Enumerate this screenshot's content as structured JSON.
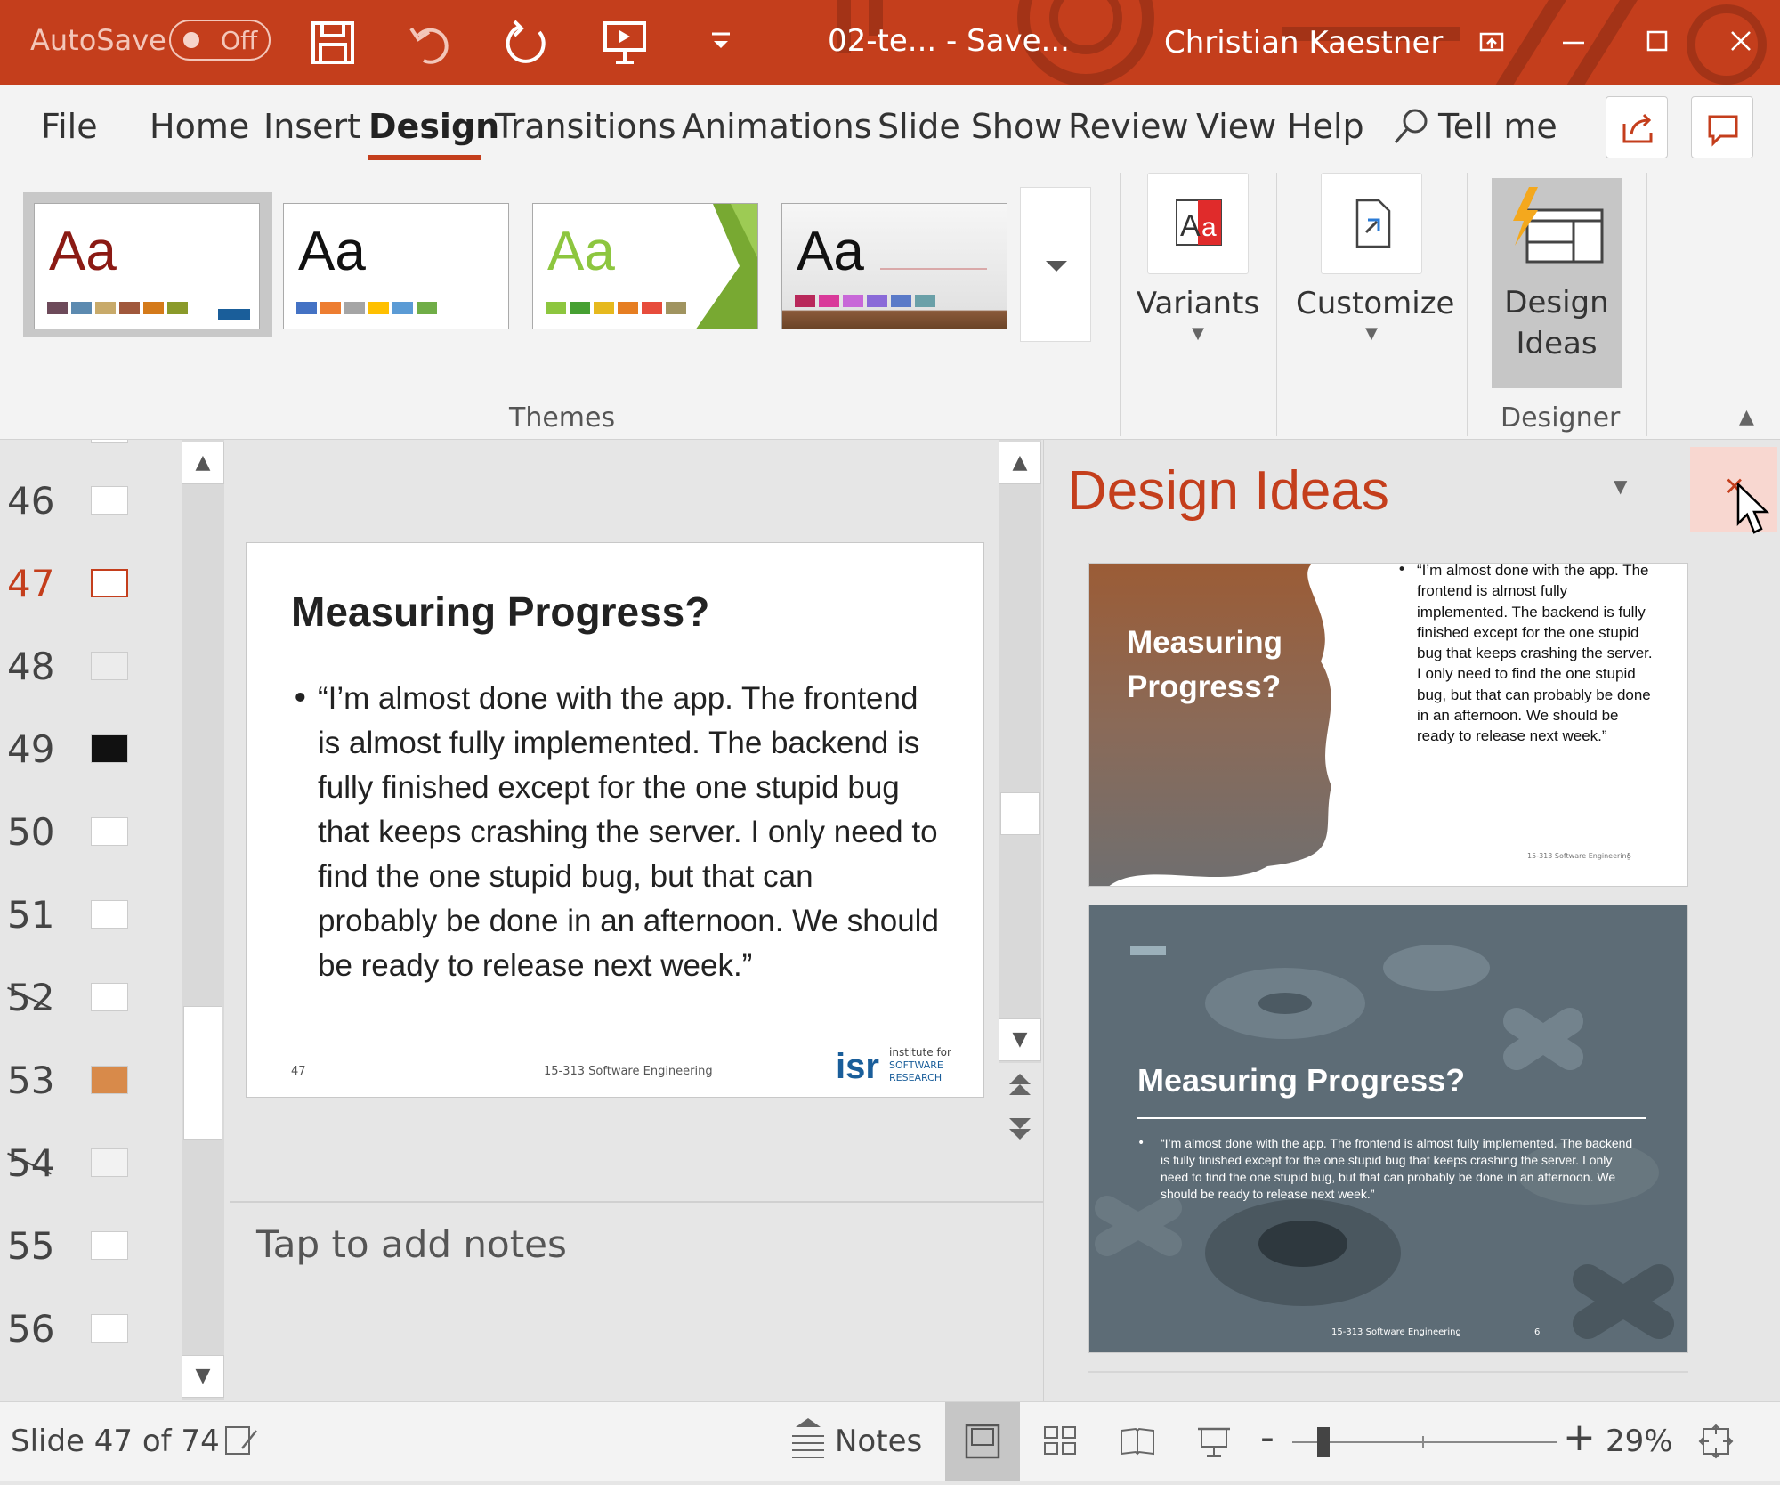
{
  "titlebar": {
    "autosave_label": "AutoSave",
    "autosave_state": "Off",
    "doc_title": "02-te...  -  Save...",
    "user_name": "Christian Kaestner",
    "accent": "#c43e1c"
  },
  "tabs": [
    "File",
    "Home",
    "Insert",
    "Design",
    "Transitions",
    "Animations",
    "Slide Show",
    "Review",
    "View",
    "Help",
    "Tell me"
  ],
  "ribbon": {
    "themes_label": "Themes",
    "theme_aa": "Aa",
    "variants_label": "Variants",
    "customize_label": "Customize",
    "design_ideas_label_1": "Design",
    "design_ideas_label_2": "Ideas",
    "designer_label": "Designer"
  },
  "thumbnails": [
    "46",
    "47",
    "48",
    "49",
    "50",
    "51",
    "52",
    "53",
    "54",
    "55",
    "56"
  ],
  "current_slide": "47",
  "slide": {
    "title": "Measuring Progress?",
    "bullet": "“I’m almost done with the app. The frontend is almost fully implemented. The backend is fully finished except for the one stupid bug that keeps crashing the server. I only need to find the one stupid bug, but that can probably be done in an afternoon. We should be ready to release next week.”",
    "number": "47",
    "footer": "15-313 Software Engineering",
    "logo_text": "isr",
    "logo_sub_1": "institute for",
    "logo_sub_2": "SOFTWARE",
    "logo_sub_3": "RESEARCH"
  },
  "notes_placeholder": "Tap to add notes",
  "design_ideas": {
    "title": "Design Ideas",
    "idea1": {
      "title": "Measuring Progress?",
      "text": "“I’m almost done with the app. The frontend is almost fully implemented. The backend is fully finished except for the one stupid bug that keeps crashing the server. I only need to find the one stupid bug, but that can probably be done in an afternoon. We should be ready to release next week.”",
      "footer": "15-313 Software Engineering",
      "number": "5"
    },
    "idea2": {
      "title": "Measuring Progress?",
      "text": "“I’m almost done with the app. The frontend is almost fully implemented. The backend is fully finished except for the one stupid bug that keeps crashing the server. I only need to find the one stupid bug, but that can probably be done in an afternoon. We should be ready to release next week.”",
      "footer": "15-313 Software Engineering",
      "number": "6"
    }
  },
  "statusbar": {
    "slide_counter": "Slide 47 of 74",
    "notes_label": "Notes",
    "zoom_minus": "-",
    "zoom_plus": "+",
    "zoom": "29%"
  }
}
